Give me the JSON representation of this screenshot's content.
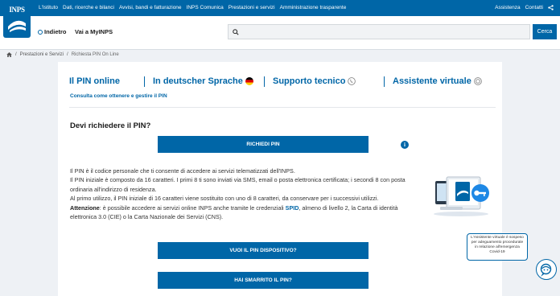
{
  "topbar": {
    "logo_text": "INPS",
    "nav": [
      "L'Istituto",
      "Dati, ricerche e bilanci",
      "Avvisi, bandi e fatturazione",
      "INPS Comunica",
      "Prestazioni e servizi",
      "Amministrazione trasparente"
    ],
    "right": [
      "Assistenza",
      "Contatti"
    ]
  },
  "header": {
    "back_label": "Indietro",
    "myinps_label": "Vai a MyINPS",
    "search_placeholder": "",
    "search_button": "Cerca"
  },
  "breadcrumb": {
    "items": [
      "Prestazioni e Servizi",
      "Richiesta PIN On Line"
    ]
  },
  "tabs": {
    "pin_online": "Il PIN online",
    "deutsch": "In deutscher Sprache",
    "supporto": "Supporto tecnico",
    "assistente": "Assistente virtuale",
    "consulta": "Consulta come ottenere e gestire il PIN"
  },
  "main": {
    "question": "Devi richiedere il PIN?",
    "richiedi_button": "RICHIEDI PIN",
    "info_icon": "i",
    "p1": "Il PIN è il codice personale che ti consente di accedere ai servizi telematizzati dell'INPS.",
    "p2": "Il PIN iniziale è composto da 16 caratteri. I primi 8 ti sono inviati via SMS, email o posta elettronica certificata; i secondi 8 con posta ordinaria all'indirizzo di residenza.",
    "p3": "Al primo utilizzo, il PIN iniziale di 16 caratteri viene sostituito con uno di 8 caratteri, da conservare per i successivi utilizzi.",
    "p4_label": "Attenzione",
    "p4_a": ": è possibile accedere ai servizi online INPS anche tramite le credenziali ",
    "p4_spid": "SPID",
    "p4_b": ", almeno di livello 2, la Carta di identità elettronica 3.0 (CIE) o la Carta Nazionale dei Servizi (CNS).",
    "dispositivo_button": "VUOI IL PIN DISPOSITIVO?",
    "smarrito_button": "HAI SMARRITO IL PIN?"
  },
  "tooltip": {
    "text": "L'Assistente virtuale è sospeso per adeguamento procedurale in relazione all'emergenza Covid-19"
  },
  "colors": {
    "brand": "#0066a7",
    "background": "#eef1f5"
  }
}
